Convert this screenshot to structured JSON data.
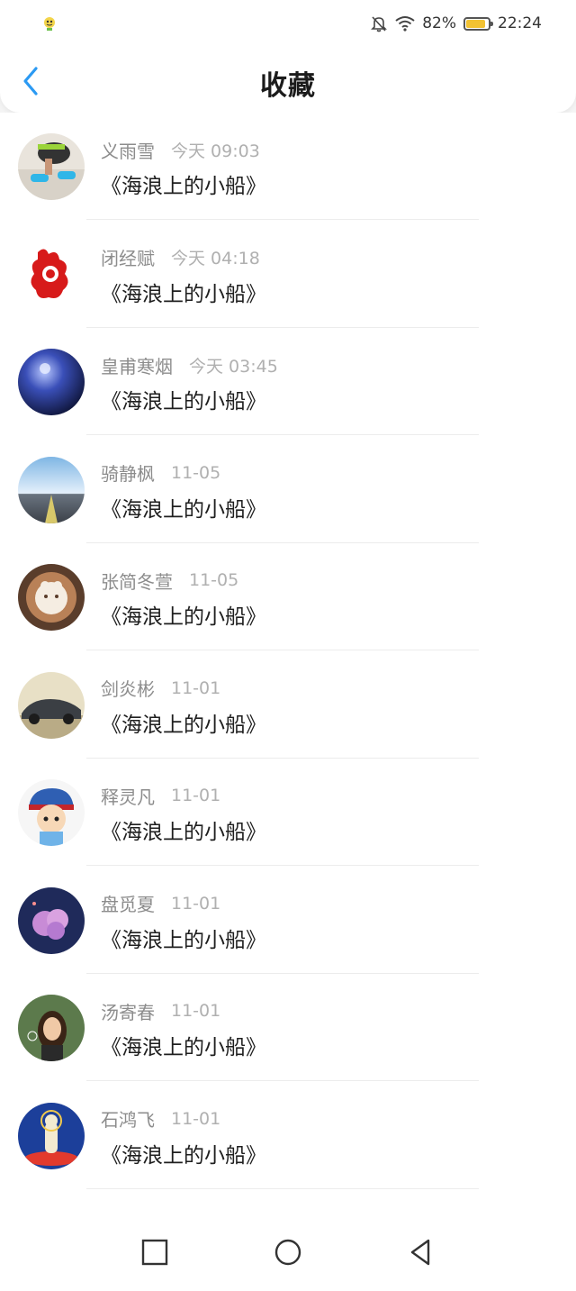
{
  "status_bar": {
    "battery": "82%",
    "battery_level": 0.82,
    "time": "22:24",
    "icons": [
      "bell-off-icon",
      "wifi-icon",
      "battery-icon"
    ],
    "app_icon": "notification-app-icon"
  },
  "header": {
    "title": "收藏",
    "back_icon": "chevron-left-icon",
    "accent_color": "#2b9af3"
  },
  "favorites": [
    {
      "name": "义雨雪",
      "time": "今天 09:03",
      "title": "《海浪上的小船》",
      "avatar": "avatar-runner-shoes"
    },
    {
      "name": "闭经赋",
      "time": "今天 04:18",
      "title": "《海浪上的小船》",
      "avatar": "avatar-red-papercut-rooster"
    },
    {
      "name": "皇甫寒烟",
      "time": "今天 03:45",
      "title": "《海浪上的小船》",
      "avatar": "avatar-blue-night"
    },
    {
      "name": "骑静枫",
      "time": "11-05",
      "title": "《海浪上的小船》",
      "avatar": "avatar-sky-road"
    },
    {
      "name": "张简冬萱",
      "time": "11-05",
      "title": "《海浪上的小船》",
      "avatar": "avatar-latte-art"
    },
    {
      "name": "剑炎彬",
      "time": "11-01",
      "title": "《海浪上的小船》",
      "avatar": "avatar-sports-car"
    },
    {
      "name": "释灵凡",
      "time": "11-01",
      "title": "《海浪上的小船》",
      "avatar": "avatar-cartoon-boy"
    },
    {
      "name": "盘觅夏",
      "time": "11-01",
      "title": "《海浪上的小船》",
      "avatar": "avatar-purple-cloud"
    },
    {
      "name": "汤寄春",
      "time": "11-01",
      "title": "《海浪上的小船》",
      "avatar": "avatar-girl-bubbles"
    },
    {
      "name": "石鸿飞",
      "time": "11-01",
      "title": "《海浪上的小船》",
      "avatar": "avatar-guanyin-statue"
    }
  ],
  "navbar": {
    "icons": [
      "recent-apps-icon",
      "home-icon",
      "back-icon"
    ]
  }
}
